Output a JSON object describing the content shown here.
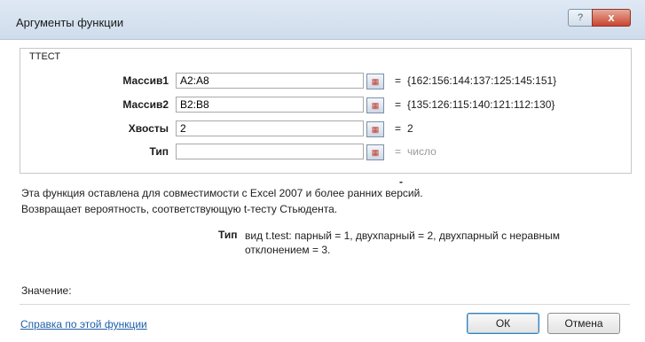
{
  "window": {
    "title": "Аргументы функции",
    "help_button": "?",
    "close_button": "x"
  },
  "function": {
    "name": "ТТЕСТ",
    "args": [
      {
        "label": "Массив1",
        "value": "A2:A8",
        "result": "{162:156:144:137:125:145:151}"
      },
      {
        "label": "Массив2",
        "value": "B2:B8",
        "result": "{135:126:115:140:121:112:130}"
      },
      {
        "label": "Хвосты",
        "value": "2",
        "result": "2"
      },
      {
        "label": "Тип",
        "value": "",
        "result": "число"
      }
    ],
    "equals": "=",
    "dash": "-"
  },
  "description": {
    "line1": "Эта функция оставлена для совместимости с Excel 2007 и более ранних версий.",
    "line2": "Возвращает вероятность, соответствующую t-тесту Стьюдента.",
    "arg_label": "Тип",
    "arg_text": "вид t.test: парный = 1, двухпарный = 2, двухпарный с неравным отклонением = 3."
  },
  "footer": {
    "value_label": "Значение:",
    "help_link": "Справка по этой функции",
    "ok": "ОК",
    "cancel": "Отмена"
  }
}
